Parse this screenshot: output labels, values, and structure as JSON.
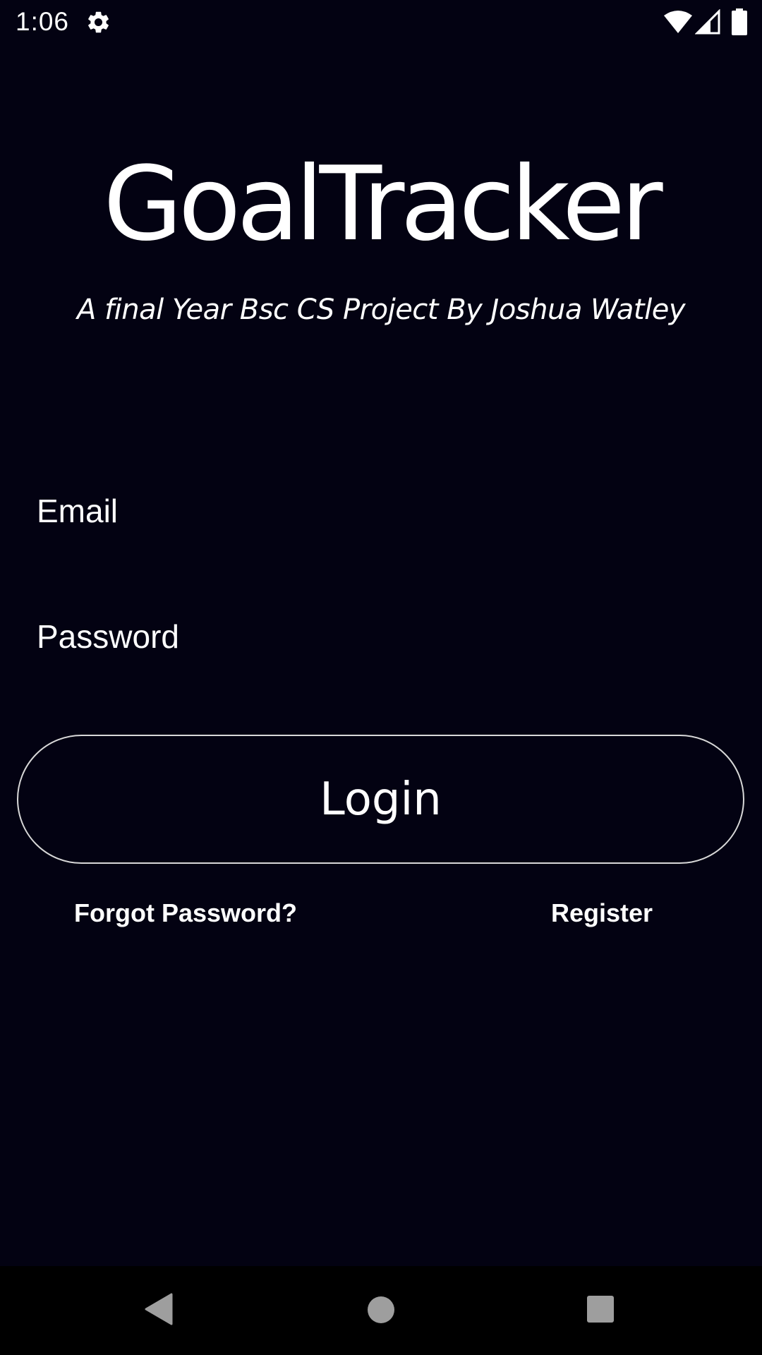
{
  "status_bar": {
    "time": "1:06",
    "icons": [
      "gear-icon",
      "wifi-icon",
      "cell-signal-icon",
      "battery-icon"
    ]
  },
  "app": {
    "title": "GoalTracker",
    "subtitle": "A final Year Bsc CS Project By Joshua Watley"
  },
  "form": {
    "email_placeholder": "Email",
    "email_value": "",
    "password_placeholder": "Password",
    "password_value": "",
    "login_label": "Login"
  },
  "links": {
    "forgot_password": "Forgot Password?",
    "register": "Register"
  },
  "nav_bar": {
    "icons": [
      "back-icon",
      "home-icon",
      "recents-icon"
    ]
  },
  "colors": {
    "background": "#030212",
    "text": "#ffffff",
    "button_border": "#d8d8d8",
    "nav_background": "#000000",
    "nav_icon": "#9e9e9e"
  }
}
